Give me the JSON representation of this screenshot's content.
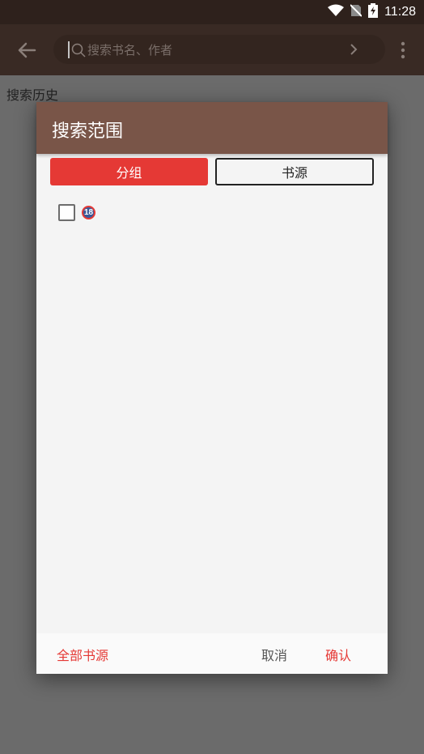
{
  "status_bar": {
    "time": "11:28",
    "icons": [
      "wifi-icon",
      "no-sim-icon",
      "battery-charging-icon"
    ]
  },
  "toolbar": {
    "back_icon": "arrow-left-icon",
    "search_placeholder": "搜索书名、作者",
    "search_icon": "search-icon",
    "submit_icon": "chevron-right-icon",
    "menu_icon": "more-vertical-icon"
  },
  "history": {
    "label": "搜索历史"
  },
  "dialog": {
    "title": "搜索范围",
    "tabs": [
      {
        "label": "分组",
        "selected": true
      },
      {
        "label": "书源",
        "selected": false
      }
    ],
    "groups": [
      {
        "label": "18-badge-icon",
        "checked": false
      }
    ],
    "footer": {
      "all_sources": "全部书源",
      "cancel": "取消",
      "confirm": "确认"
    }
  },
  "colors": {
    "status_bar": "#2e211c",
    "toolbar": "#392a24",
    "dialog_header": "#795548",
    "accent": "#e53935",
    "scrim": "#6b6b6b"
  }
}
